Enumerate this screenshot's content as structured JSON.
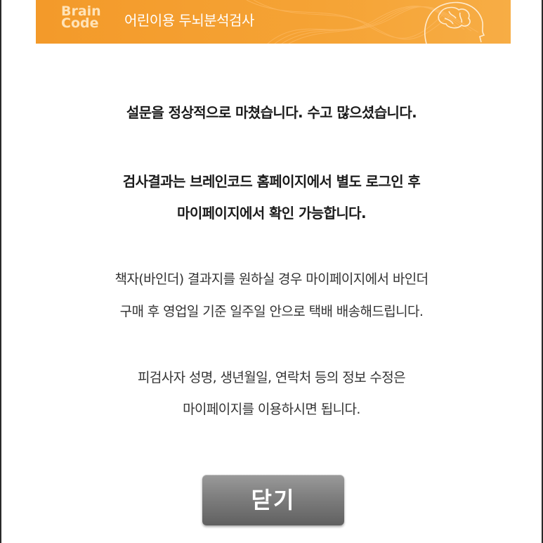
{
  "header": {
    "logo_line1": "Brain",
    "logo_line2": "Code",
    "title": "어린이용 두뇌분석검사",
    "brand_color": "#f39a2a",
    "icon": "head-brain-icon"
  },
  "messages": {
    "completed": "설문을 정상적으로 마쳤습니다. 수고 많으셨습니다.",
    "result_line1": "검사결과는 브레인코드 홈페이지에서 별도 로그인 후",
    "result_line2": "마이페이지에서 확인 가능합니다.",
    "binder_line1": "책자(바인더) 결과지를 원하실 경우 마이페이지에서 바인더",
    "binder_line2": "구매 후 영업일 기준 일주일 안으로 택배 배송해드립니다.",
    "edit_line1": "피검사자 성명, 생년월일, 연락처 등의 정보 수정은",
    "edit_line2": "마이페이지를 이용하시면 됩니다."
  },
  "close_button": {
    "label": "닫기",
    "color": "#7e7e7e"
  }
}
